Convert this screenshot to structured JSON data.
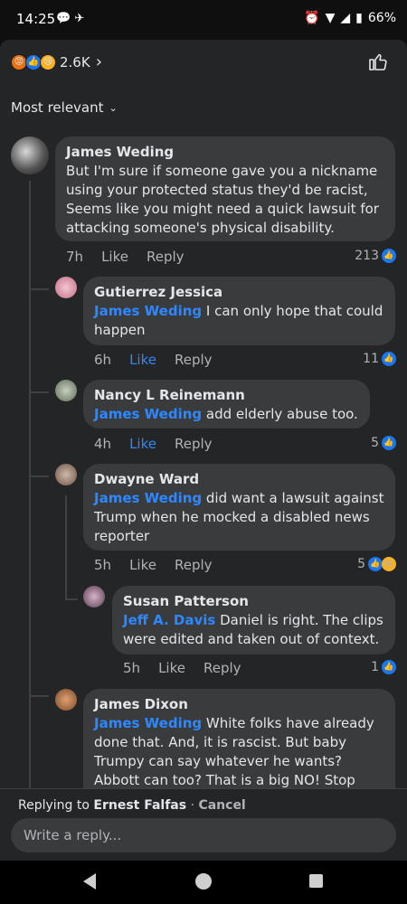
{
  "status_bar": {
    "time": "14:25",
    "battery": "66%"
  },
  "header": {
    "reaction_count": "2.6K",
    "sort_label": "Most relevant"
  },
  "comments": [
    {
      "author": "James Weding",
      "text": "But I'm sure if someone gave you a nickname using your protected status they'd be racist, Seems like you might need a quick lawsuit for attacking someone's physical disability.",
      "time": "7h",
      "like": "Like",
      "reply": "Reply",
      "likes": "213"
    }
  ],
  "replies": [
    {
      "author": "Gutierrez Jessica",
      "mention": "James Weding",
      "text": " I can only hope that could happen",
      "time": "6h",
      "like": "Like",
      "reply": "Reply",
      "likes": "11"
    },
    {
      "author": "Nancy L Reinemann",
      "mention": "James Weding",
      "text": " add elderly abuse too.",
      "time": "4h",
      "like": "Like",
      "reply": "Reply",
      "likes": "5"
    },
    {
      "author": "Dwayne Ward",
      "mention": "James Weding",
      "text": " did want a lawsuit against Trump when he mocked a disabled news reporter",
      "time": "5h",
      "like": "Like",
      "reply": "Reply",
      "likes": "5"
    },
    {
      "author": "Susan Patterson",
      "mention": "Jeff A. Davis",
      "text": " Daniel is right. The clips were edited and taken out of context.",
      "time": "5h",
      "like": "Like",
      "reply": "Reply",
      "likes": "1"
    },
    {
      "author": "James Dixon",
      "mention": "James Weding",
      "text": " White folks have already done that.  And, it is rascist.  But baby Trumpy can say whatever he wants? Abbott can too?  That is a big NO!  Stop"
    }
  ],
  "composer": {
    "replying_prefix": "Replying to ",
    "replying_name": "Ernest Falfas",
    "separator": " · ",
    "cancel": "Cancel",
    "placeholder": "Write a reply..."
  },
  "colors": {
    "accent": "#2d88ff",
    "bubble": "#3a3b3c",
    "sheet": "#242526"
  }
}
